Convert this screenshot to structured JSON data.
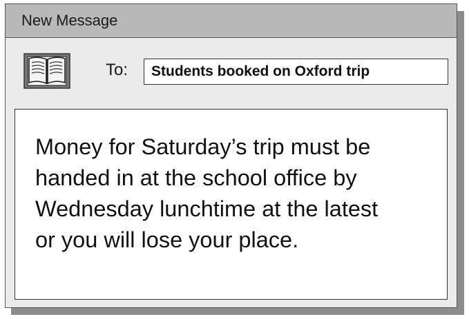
{
  "window": {
    "title": "New Message"
  },
  "header": {
    "to_label": "To:",
    "to_value": "Students booked on Oxford trip",
    "address_book_icon": "open-book-icon"
  },
  "message": {
    "body": "Money for Saturday’s trip must be\nhanded in at the school office by\nWednesday lunchtime at the latest\nor you will lose your place."
  },
  "colors": {
    "titlebar": "#b9b9b9",
    "window_background": "#ebebeb",
    "shadow": "#8c8c8c",
    "field_background": "#ffffff",
    "text": "#111111"
  }
}
